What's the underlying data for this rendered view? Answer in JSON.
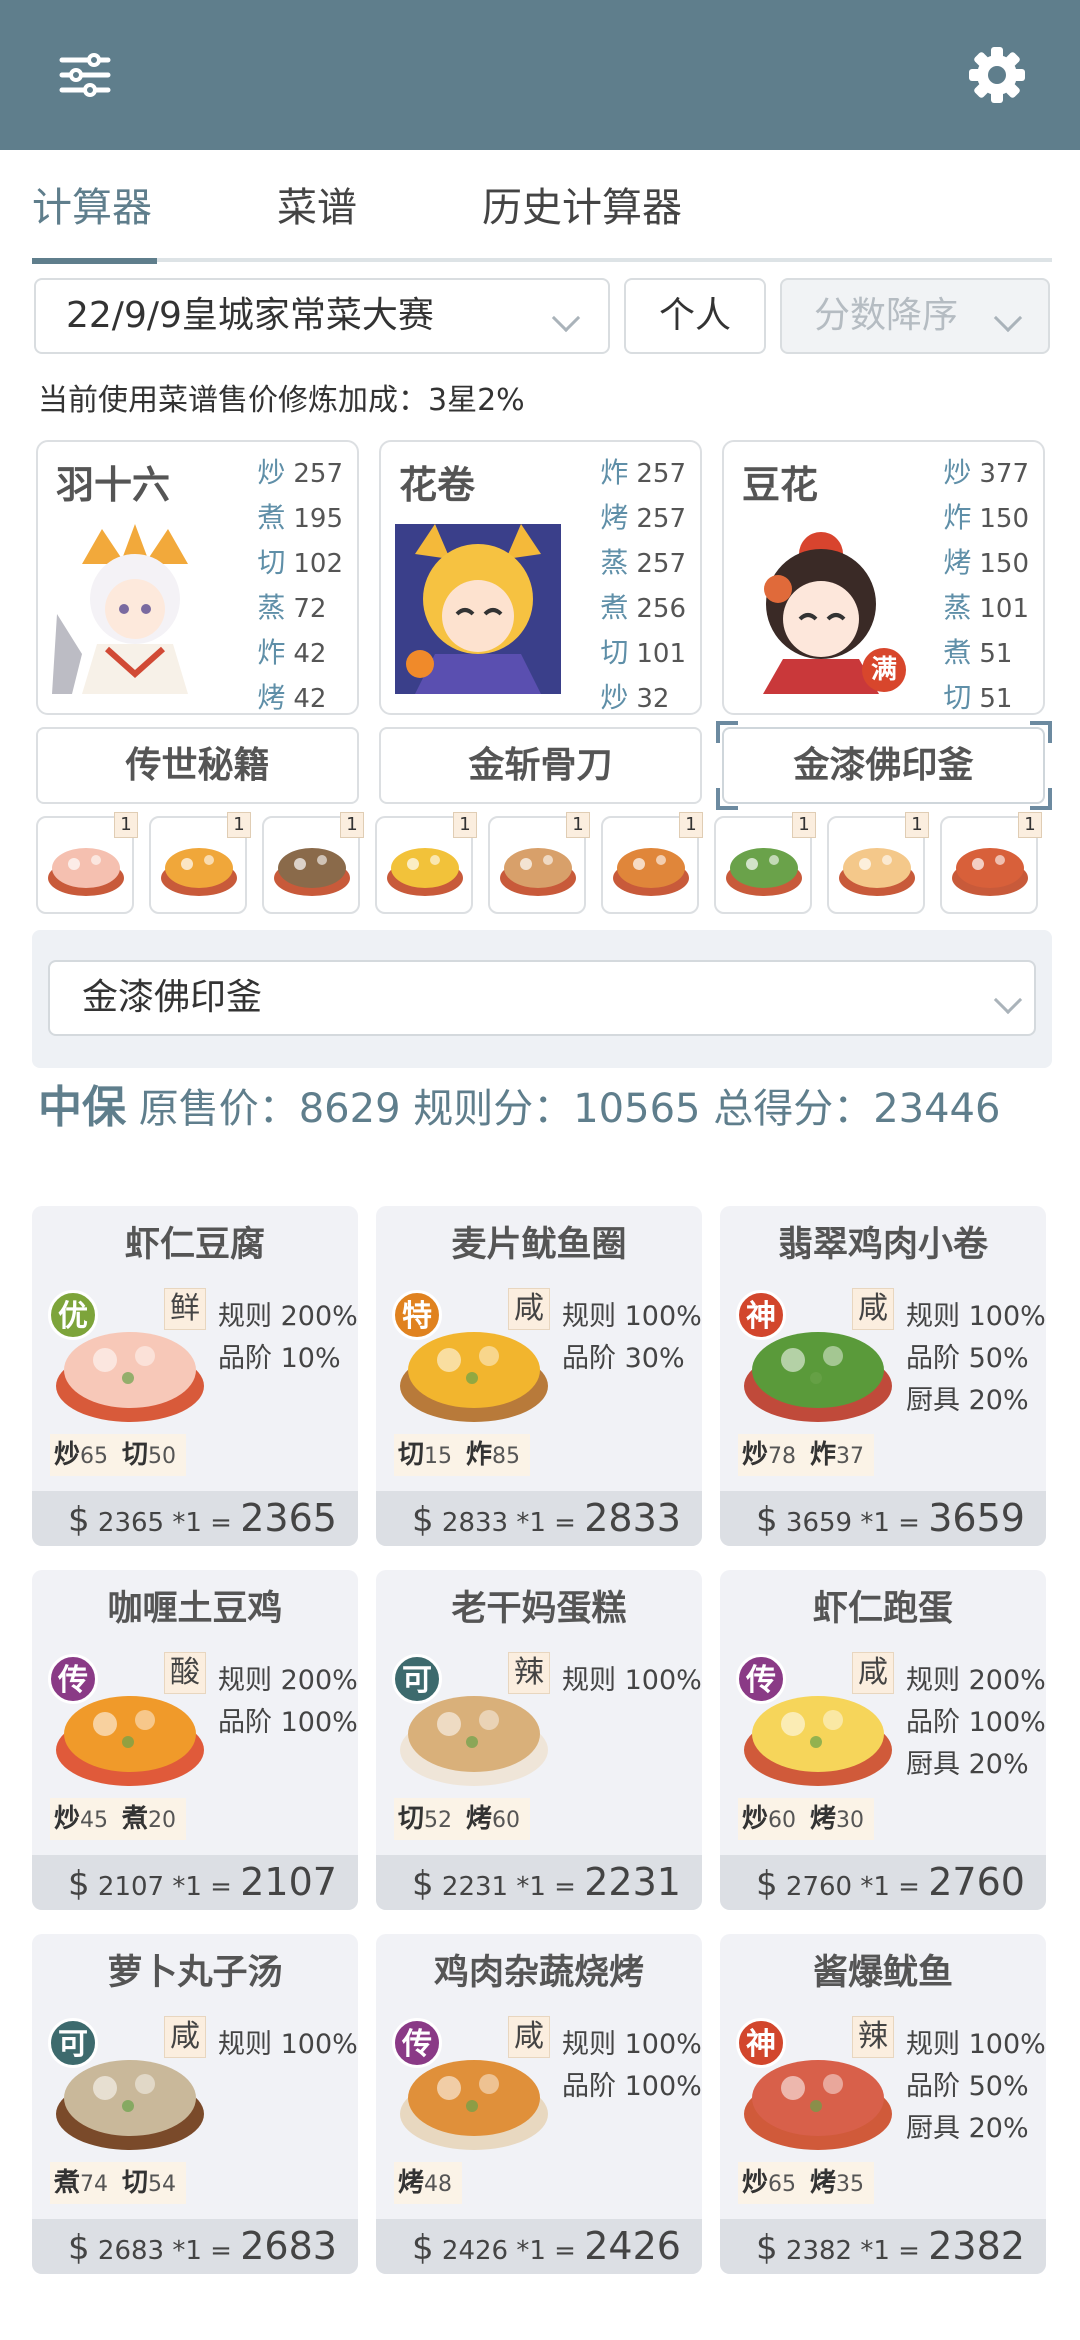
{
  "toolbar": {
    "menu_icon": "sliders-icon",
    "settings_icon": "gear-icon"
  },
  "tabs": [
    {
      "label": "计算器",
      "active": true
    },
    {
      "label": "菜谱"
    },
    {
      "label": "历史计算器"
    }
  ],
  "filters": {
    "contest": "22/9/9皇城家常菜大赛",
    "mode": "个人",
    "sort": "分数降序"
  },
  "bonus_text": "当前使用菜谱售价修炼加成：3星2%",
  "chefs": [
    {
      "name": "羽十六",
      "stats": [
        {
          "k": "炒",
          "v": "257"
        },
        {
          "k": "煮",
          "v": "195"
        },
        {
          "k": "切",
          "v": "102"
        },
        {
          "k": "蒸",
          "v": "72"
        },
        {
          "k": "炸",
          "v": "42"
        },
        {
          "k": "烤",
          "v": "42"
        }
      ],
      "equip": "传世秘籍"
    },
    {
      "name": "花卷",
      "stats": [
        {
          "k": "炸",
          "v": "257"
        },
        {
          "k": "烤",
          "v": "257"
        },
        {
          "k": "蒸",
          "v": "257"
        },
        {
          "k": "煮",
          "v": "256"
        },
        {
          "k": "切",
          "v": "101"
        },
        {
          "k": "炒",
          "v": "32"
        }
      ],
      "equip": "金斩骨刀"
    },
    {
      "name": "豆花",
      "badge": "满",
      "stats": [
        {
          "k": "炒",
          "v": "377"
        },
        {
          "k": "炸",
          "v": "150"
        },
        {
          "k": "烤",
          "v": "150"
        },
        {
          "k": "蒸",
          "v": "101"
        },
        {
          "k": "煮",
          "v": "51"
        },
        {
          "k": "切",
          "v": "51"
        }
      ],
      "equip": "金漆佛印釜"
    }
  ],
  "recipe_counts": [
    "1",
    "1",
    "1",
    "1",
    "1",
    "1",
    "1",
    "1",
    "1"
  ],
  "panel": {
    "selected_equip": "金漆佛印釜"
  },
  "score": {
    "label": "中保",
    "original": "原售价：8629",
    "rule": "规则分：10565",
    "total": "总得分：23446"
  },
  "dishes": [
    {
      "name": "虾仁豆腐",
      "grade": "优",
      "grade_color": "#7da43a",
      "flavor": "鲜",
      "rules": [
        "规则 200%",
        "品阶 10%"
      ],
      "skills": [
        {
          "k": "炒",
          "v": "65"
        },
        {
          "k": "切",
          "v": "50"
        }
      ],
      "price_base": "2365",
      "mult": "*1",
      "price_total": "2365"
    },
    {
      "name": "麦片鱿鱼圈",
      "grade": "特",
      "grade_color": "#e0821f",
      "flavor": "咸",
      "rules": [
        "规则 100%",
        "品阶 30%"
      ],
      "skills": [
        {
          "k": "切",
          "v": "15"
        },
        {
          "k": "炸",
          "v": "85"
        }
      ],
      "price_base": "2833",
      "mult": "*1",
      "price_total": "2833"
    },
    {
      "name": "翡翠鸡肉小卷",
      "grade": "神",
      "grade_color": "#d2462c",
      "flavor": "咸",
      "rules": [
        "规则 100%",
        "品阶 50%",
        "厨具 20%"
      ],
      "skills": [
        {
          "k": "炒",
          "v": "78"
        },
        {
          "k": "炸",
          "v": "37"
        }
      ],
      "price_base": "3659",
      "mult": "*1",
      "price_total": "3659"
    },
    {
      "name": "咖喱土豆鸡",
      "grade": "传",
      "grade_color": "#8a3a86",
      "flavor": "酸",
      "rules": [
        "规则 200%",
        "品阶 100%"
      ],
      "skills": [
        {
          "k": "炒",
          "v": "45"
        },
        {
          "k": "煮",
          "v": "20"
        }
      ],
      "price_base": "2107",
      "mult": "*1",
      "price_total": "2107"
    },
    {
      "name": "老干妈蛋糕",
      "grade": "可",
      "grade_color": "#3d6a6d",
      "flavor": "辣",
      "rules": [
        "规则 100%"
      ],
      "skills": [
        {
          "k": "切",
          "v": "52"
        },
        {
          "k": "烤",
          "v": "60"
        }
      ],
      "price_base": "2231",
      "mult": "*1",
      "price_total": "2231"
    },
    {
      "name": "虾仁跑蛋",
      "grade": "传",
      "grade_color": "#8a3a86",
      "flavor": "咸",
      "rules": [
        "规则 200%",
        "品阶 100%",
        "厨具 20%"
      ],
      "skills": [
        {
          "k": "炒",
          "v": "60"
        },
        {
          "k": "烤",
          "v": "30"
        }
      ],
      "price_base": "2760",
      "mult": "*1",
      "price_total": "2760"
    },
    {
      "name": "萝卜丸子汤",
      "grade": "可",
      "grade_color": "#3d6a6d",
      "flavor": "咸",
      "rules": [
        "规则 100%"
      ],
      "skills": [
        {
          "k": "煮",
          "v": "74"
        },
        {
          "k": "切",
          "v": "54"
        }
      ],
      "price_base": "2683",
      "mult": "*1",
      "price_total": "2683"
    },
    {
      "name": "鸡肉杂蔬烧烤",
      "grade": "传",
      "grade_color": "#8a3a86",
      "flavor": "咸",
      "rules": [
        "规则 100%",
        "品阶 100%"
      ],
      "skills": [
        {
          "k": "烤",
          "v": "48"
        }
      ],
      "price_base": "2426",
      "mult": "*1",
      "price_total": "2426"
    },
    {
      "name": "酱爆鱿鱼",
      "grade": "神",
      "grade_color": "#d2462c",
      "flavor": "辣",
      "rules": [
        "规则 100%",
        "品阶 50%",
        "厨具 20%"
      ],
      "skills": [
        {
          "k": "炒",
          "v": "65"
        },
        {
          "k": "烤",
          "v": "35"
        }
      ],
      "price_base": "2382",
      "mult": "*1",
      "price_total": "2382"
    }
  ]
}
